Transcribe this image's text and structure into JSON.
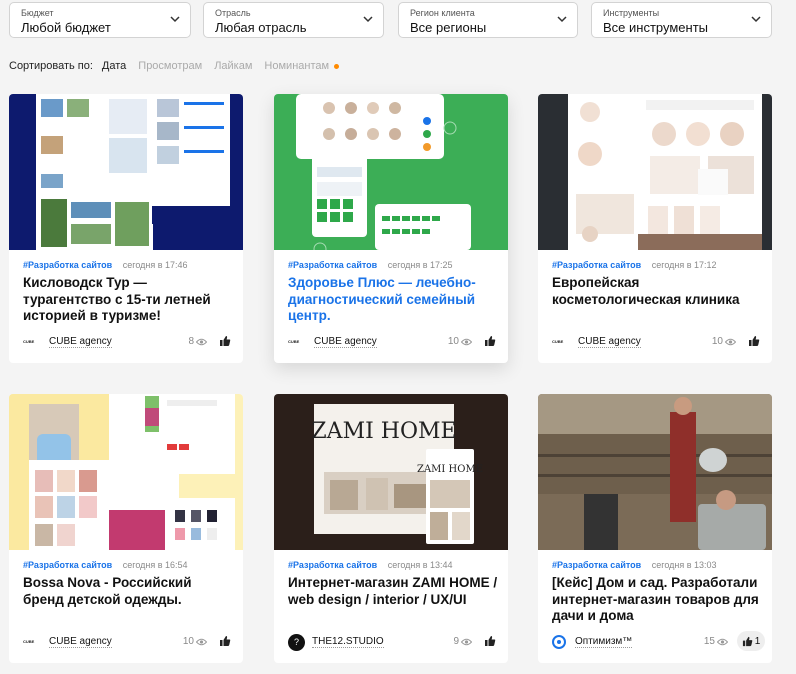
{
  "filters": [
    {
      "label": "Бюджет",
      "value": "Любой бюджет"
    },
    {
      "label": "Отрасль",
      "value": "Любая отрасль"
    },
    {
      "label": "Регион клиента",
      "value": "Все регионы"
    },
    {
      "label": "Инструменты",
      "value": "Все инструменты"
    }
  ],
  "sort": {
    "label": "Сортировать по:",
    "options": [
      "Дата",
      "Просмотрам",
      "Лайкам",
      "Номинантам"
    ],
    "active": "Дата"
  },
  "cards": [
    {
      "tag": "#Разработка сайтов",
      "time": "сегодня в 17:46",
      "title": "Кисловодск Тур — турагентство с 15-ти летней историей в туризме!",
      "author": "CUBE agency",
      "views": "8"
    },
    {
      "tag": "#Разработка сайтов",
      "time": "сегодня в 17:25",
      "title": "Здоровье Плюс — лечебно-диагностический семейный центр.",
      "author": "CUBE agency",
      "views": "10"
    },
    {
      "tag": "#Разработка сайтов",
      "time": "сегодня в 17:12",
      "title": "Европейская косметологическая клиника",
      "author": "CUBE agency",
      "views": "10"
    },
    {
      "tag": "#Разработка сайтов",
      "time": "сегодня в 16:54",
      "title": "Bossa Nova - Российский бренд детской одежды.",
      "author": "CUBE agency",
      "views": "10"
    },
    {
      "tag": "#Разработка сайтов",
      "time": "сегодня в 13:44",
      "title": "Интернет-магазин ZAMI HOME / web design / interior / UX/UI",
      "author": "THE12.STUDIO",
      "views": "9",
      "thumb_text": "ZAMI HOME"
    },
    {
      "tag": "#Разработка сайтов",
      "time": "сегодня в 13:03",
      "title": "[Кейс] Дом и сад. Разработали интернет-магазин товаров для дачи и дома",
      "author": "Оптимизм™",
      "views": "15",
      "likes": "1"
    }
  ],
  "logos": {
    "cube": "CUBE",
    "the12": "?"
  },
  "colors": {
    "accent": "#1a73e8",
    "nominee_dot": "#ff8a00"
  }
}
